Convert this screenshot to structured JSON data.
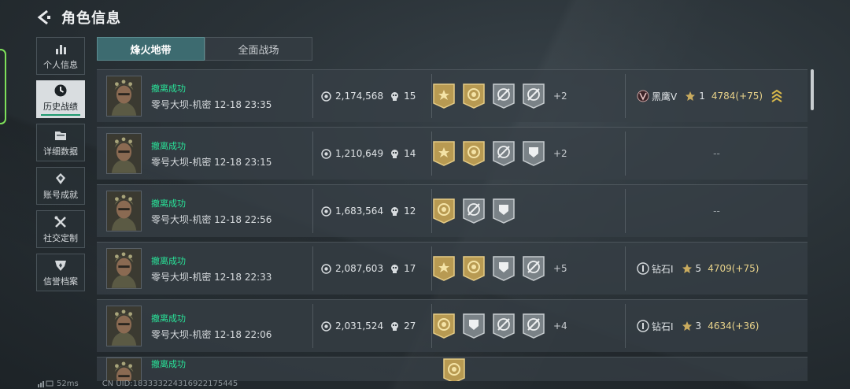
{
  "header": {
    "title": "角色信息"
  },
  "nav": [
    {
      "label": "个人信息",
      "icon": "bar-chart-icon",
      "active": false
    },
    {
      "label": "历史战绩",
      "icon": "clock-icon",
      "active": true
    },
    {
      "label": "详细数据",
      "icon": "folder-icon",
      "active": false
    },
    {
      "label": "账号成就",
      "icon": "achievement-icon",
      "active": false
    },
    {
      "label": "社交定制",
      "icon": "tools-icon",
      "active": false
    },
    {
      "label": "信誉档案",
      "icon": "shield-icon",
      "active": false
    }
  ],
  "tabs": [
    {
      "label": "烽火地带",
      "active": true
    },
    {
      "label": "全面战场",
      "active": false
    }
  ],
  "records": [
    {
      "status": "撤离成功",
      "detail": "零号大坝-机密 12-18 23:35",
      "value": "2,174,568",
      "kills": "15",
      "more": "+2",
      "rank_name": "黑鹰V",
      "stars": "1",
      "score": "4784",
      "delta": "(+75)",
      "has_rank": true
    },
    {
      "status": "撤离成功",
      "detail": "零号大坝-机密 12-18 23:15",
      "value": "1,210,649",
      "kills": "14",
      "more": "+2",
      "empty": "--",
      "has_rank": false
    },
    {
      "status": "撤离成功",
      "detail": "零号大坝-机密 12-18 22:56",
      "value": "1,683,564",
      "kills": "12",
      "more": "",
      "empty": "--",
      "has_rank": false
    },
    {
      "status": "撤离成功",
      "detail": "零号大坝-机密 12-18 22:33",
      "value": "2,087,603",
      "kills": "17",
      "more": "+5",
      "rank_name": "钻石I",
      "stars": "5",
      "score": "4709",
      "delta": "(+75)",
      "has_rank": true
    },
    {
      "status": "撤离成功",
      "detail": "零号大坝-机密 12-18 22:06",
      "value": "2,031,524",
      "kills": "27",
      "more": "+4",
      "rank_name": "钻石I",
      "stars": "3",
      "score": "4634",
      "delta": "(+36)",
      "has_rank": true
    },
    {
      "status": "撤离成功"
    }
  ],
  "footer": {
    "ping": "52ms",
    "uid": "CN UID:183333224316922175445"
  },
  "colors": {
    "accent": "#29e59a",
    "tab_active": "#3d6b70",
    "gold": "#e8d28a"
  }
}
